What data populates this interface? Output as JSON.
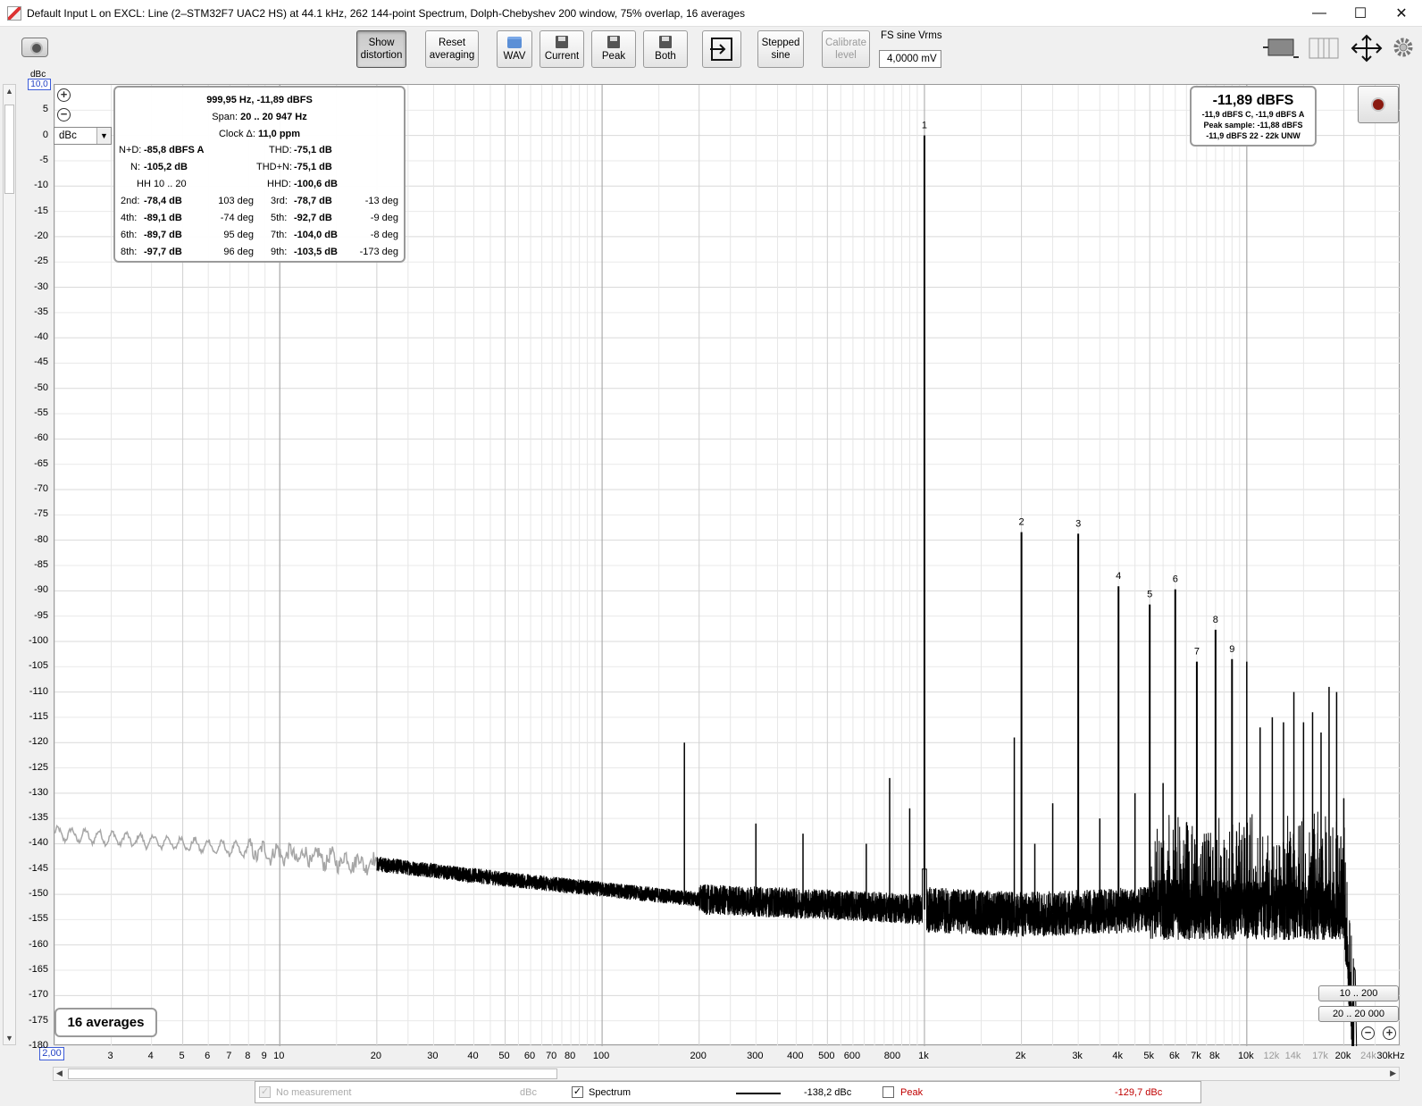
{
  "window": {
    "title": "Default Input L on EXCL: Line (2–STM32F7 UAC2 HS) at 44.1 kHz, 262 144-point Spectrum, Dolph-Chebyshev 200 window, 75% overlap, 16 averages",
    "minimize": "—",
    "maximize": "☐",
    "close": "✕"
  },
  "toolbar": {
    "show_distortion": [
      "Show",
      "distortion"
    ],
    "reset_averaging": [
      "Reset",
      "averaging"
    ],
    "wav": "WAV",
    "current": "Current",
    "peak": "Peak",
    "both": "Both",
    "stepped_sine": [
      "Stepped",
      "sine"
    ],
    "calibrate_level": [
      "Calibrate",
      "level"
    ],
    "fs_label": "FS sine Vrms",
    "fs_value": "4,0000 mV"
  },
  "axis": {
    "y_unit": "dBc",
    "y_max": "10,0",
    "x_min": "2,00",
    "unit_select": "dBc",
    "y_ticks": [
      "5",
      "0",
      "-5",
      "-10",
      "-15",
      "-20",
      "-25",
      "-30",
      "-35",
      "-40",
      "-45",
      "-50",
      "-55",
      "-60",
      "-65",
      "-70",
      "-75",
      "-80",
      "-85",
      "-90",
      "-95",
      "-100",
      "-105",
      "-110",
      "-115",
      "-120",
      "-125",
      "-130",
      "-135",
      "-140",
      "-145",
      "-150",
      "-155",
      "-160",
      "-165",
      "-170",
      "-175",
      "-180"
    ],
    "x_ticks": [
      "3",
      "4",
      "5",
      "6",
      "7",
      "8",
      "9",
      "10",
      "20",
      "30",
      "40",
      "50",
      "60",
      "70",
      "80",
      "100",
      "200",
      "300",
      "400",
      "500",
      "600",
      "800",
      "1k",
      "2k",
      "3k",
      "4k",
      "5k",
      "6k",
      "7k",
      "8k",
      "10k",
      "12k",
      "14k",
      "17k",
      "20k",
      "24k",
      "30kHz"
    ]
  },
  "distortion": {
    "header": "999,95 Hz, -11,89 dBFS",
    "span_label": "Span:",
    "span_value": "20 .. 20 947 Hz",
    "clock_label": "Clock Δ:",
    "clock_value": "11,0 ppm",
    "nd_label": "N+D:",
    "nd_value": "-85,8 dBFS A",
    "thd_label": "THD:",
    "thd_value": "-75,1 dB",
    "n_label": "N:",
    "n_value": "-105,2 dB",
    "thdn_label": "THD+N:",
    "thdn_value": "-75,1 dB",
    "hh_label": "HH 10 .. 20",
    "hhd_label": "HHD:",
    "hhd_value": "-100,6 dB",
    "harmonics": [
      {
        "label": "2nd:",
        "value": "-78,4 dB",
        "phase": "103 deg"
      },
      {
        "label": "3rd:",
        "value": "-78,7 dB",
        "phase": "-13 deg"
      },
      {
        "label": "4th:",
        "value": "-89,1 dB",
        "phase": "-74 deg"
      },
      {
        "label": "5th:",
        "value": "-92,7 dB",
        "phase": "-9 deg"
      },
      {
        "label": "6th:",
        "value": "-89,7 dB",
        "phase": "95 deg"
      },
      {
        "label": "7th:",
        "value": "-104,0 dB",
        "phase": "-8 deg"
      },
      {
        "label": "8th:",
        "value": "-97,7 dB",
        "phase": "96 deg"
      },
      {
        "label": "9th:",
        "value": "-103,5 dB",
        "phase": "-173 deg"
      }
    ]
  },
  "level": {
    "main": "-11,89 dBFS",
    "line1": "-11,9 dBFS C, -11,9 dBFS A",
    "line2": "Peak sample: -11,88 dBFS",
    "line3": "-11,9 dBFS 22 - 22k UNW"
  },
  "averages_label": "16 averages",
  "span_buttons": [
    "10 .. 200",
    "20 .. 20 000"
  ],
  "legend": {
    "no_measurement": "No measurement",
    "no_measurement_unit": "dBc",
    "spectrum": "Spectrum",
    "spectrum_value": "-138,2 dBc",
    "peak": "Peak",
    "peak_value": "-129,7 dBc",
    "peak_color": "#c00000"
  },
  "chart_data": {
    "type": "line",
    "xscale": "log",
    "xlim": [
      2,
      30000
    ],
    "ylim": [
      -180,
      10
    ],
    "xlabel": "",
    "ylabel": "dBc",
    "grid": true,
    "noise_floor": [
      {
        "x": 2,
        "y": -138
      },
      {
        "x": 5,
        "y": -140
      },
      {
        "x": 10,
        "y": -142
      },
      {
        "x": 20,
        "y": -144
      },
      {
        "x": 50,
        "y": -147
      },
      {
        "x": 100,
        "y": -149
      },
      {
        "x": 200,
        "y": -151
      },
      {
        "x": 500,
        "y": -152
      },
      {
        "x": 1000,
        "y": -153
      },
      {
        "x": 2000,
        "y": -154
      },
      {
        "x": 5000,
        "y": -153
      },
      {
        "x": 10000,
        "y": -153
      },
      {
        "x": 20000,
        "y": -153
      },
      {
        "x": 21500,
        "y": -180
      }
    ],
    "harmonic_peaks": [
      {
        "n": "1",
        "x": 1000,
        "y": 0
      },
      {
        "n": "2",
        "x": 2000,
        "y": -78.4
      },
      {
        "n": "3",
        "x": 3000,
        "y": -78.7
      },
      {
        "n": "4",
        "x": 4000,
        "y": -89.1
      },
      {
        "n": "5",
        "x": 5000,
        "y": -92.7
      },
      {
        "n": "6",
        "x": 6000,
        "y": -89.7
      },
      {
        "n": "7",
        "x": 7000,
        "y": -104.0
      },
      {
        "n": "8",
        "x": 8000,
        "y": -97.7
      },
      {
        "n": "9",
        "x": 9000,
        "y": -103.5
      }
    ],
    "spurs": [
      {
        "x": 180,
        "y": -120
      },
      {
        "x": 300,
        "y": -136
      },
      {
        "x": 420,
        "y": -138
      },
      {
        "x": 660,
        "y": -140
      },
      {
        "x": 780,
        "y": -127
      },
      {
        "x": 900,
        "y": -133
      },
      {
        "x": 1900,
        "y": -119
      },
      {
        "x": 2200,
        "y": -140
      },
      {
        "x": 2500,
        "y": -132
      },
      {
        "x": 3500,
        "y": -135
      },
      {
        "x": 4500,
        "y": -130
      },
      {
        "x": 5500,
        "y": -128
      },
      {
        "x": 10000,
        "y": -104
      },
      {
        "x": 11000,
        "y": -117
      },
      {
        "x": 12000,
        "y": -115
      },
      {
        "x": 13000,
        "y": -116
      },
      {
        "x": 14000,
        "y": -110
      },
      {
        "x": 15000,
        "y": -116
      },
      {
        "x": 16000,
        "y": -114
      },
      {
        "x": 17000,
        "y": -118
      },
      {
        "x": 18000,
        "y": -109
      },
      {
        "x": 19000,
        "y": -110
      },
      {
        "x": 20000,
        "y": -131
      }
    ]
  }
}
